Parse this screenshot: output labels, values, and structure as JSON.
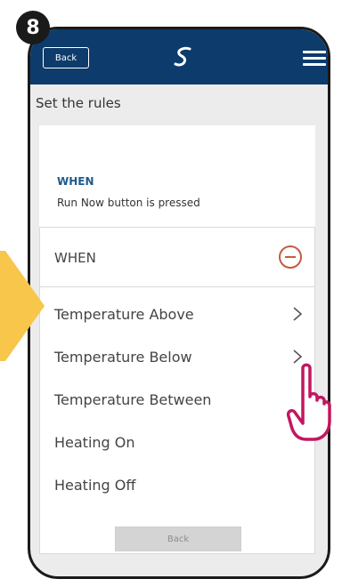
{
  "step": {
    "number": "8"
  },
  "header": {
    "back_label": "Back",
    "logo_icon": "salus-swirl-icon",
    "menu_icon": "hamburger-menu-icon"
  },
  "page": {
    "title": "Set the rules"
  },
  "summary": {
    "when_label": "WHEN",
    "description": "Run Now button is pressed"
  },
  "rules": {
    "header_label": "WHEN",
    "remove_icon": "minus-circle-icon",
    "options": [
      {
        "label": "Temperature Above",
        "has_chevron": true
      },
      {
        "label": "Temperature Below",
        "has_chevron": true
      },
      {
        "label": "Temperature Between",
        "has_chevron": false
      },
      {
        "label": "Heating On",
        "has_chevron": false
      },
      {
        "label": "Heating Off",
        "has_chevron": false
      }
    ],
    "back_label": "Back"
  },
  "colors": {
    "header_bg": "#0d3b6b",
    "accent_blue": "#1e5a8c",
    "remove_red": "#c65a3e",
    "pointer_yellow": "#f7c64a",
    "hand_magenta": "#c4165f"
  }
}
